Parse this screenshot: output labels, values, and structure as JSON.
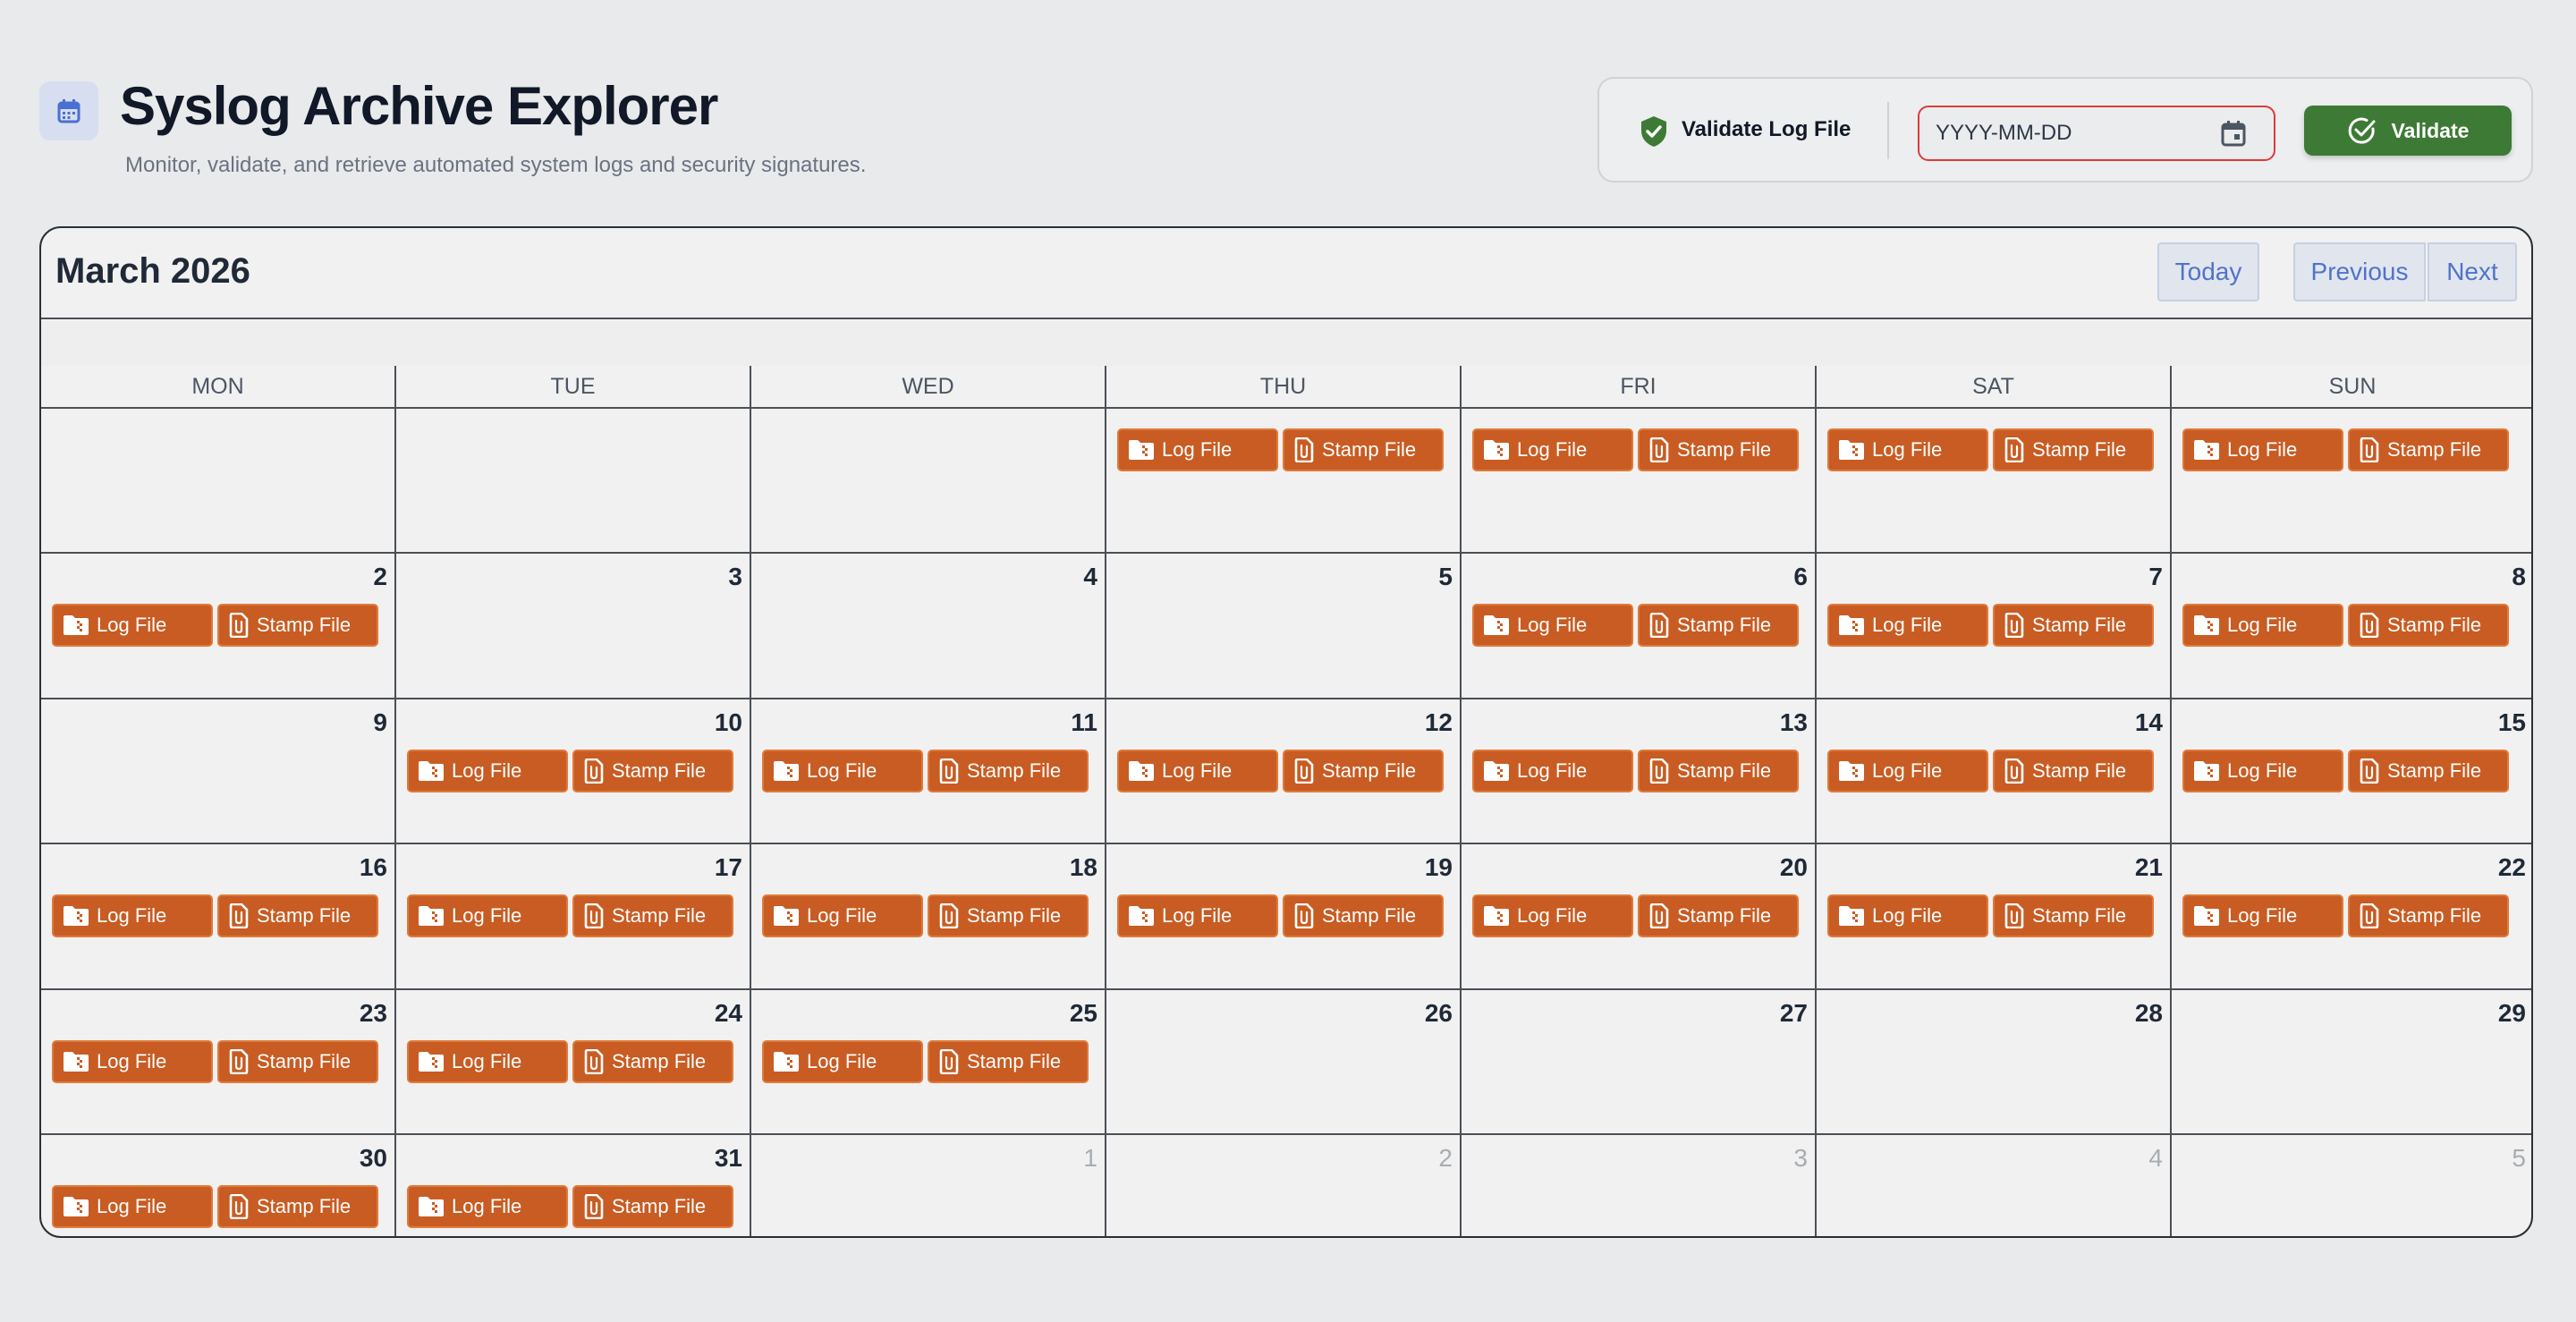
{
  "header": {
    "title": "Syslog Archive Explorer",
    "subtitle": "Monitor, validate, and retrieve automated system logs and security signatures.",
    "icon": "calendar-icon"
  },
  "validate": {
    "label": "Validate Log File",
    "placeholder": "YYYY-MM-DD",
    "value": "",
    "button_label": "Validate",
    "icons": [
      "shield-check-icon",
      "calendar-icon",
      "check-circle-icon"
    ],
    "colors": {
      "button": "#3d7a35",
      "input_border": "#dc3b3b",
      "shield": "#3d7a35"
    }
  },
  "calendar": {
    "title": "March 2026",
    "today_label": "Today",
    "previous_label": "Previous",
    "next_label": "Next",
    "day_headers": [
      "MON",
      "TUE",
      "WED",
      "THU",
      "FRI",
      "SAT",
      "SUN"
    ],
    "event_labels": {
      "log": "Log File",
      "stamp": "Stamp File"
    },
    "event_icons": {
      "log": "folder-zip-icon",
      "stamp": "file-attachment-icon"
    },
    "event_color": "#c85c23",
    "weeks": [
      [
        {
          "day": "",
          "other": false,
          "events": false
        },
        {
          "day": "",
          "other": false,
          "events": false
        },
        {
          "day": "",
          "other": false,
          "events": false
        },
        {
          "day": "",
          "other": false,
          "events": true
        },
        {
          "day": "",
          "other": false,
          "events": true
        },
        {
          "day": "",
          "other": false,
          "events": true
        },
        {
          "day": "",
          "other": false,
          "events": true
        }
      ],
      [
        {
          "day": "2",
          "other": false,
          "events": true
        },
        {
          "day": "3",
          "other": false,
          "events": false
        },
        {
          "day": "4",
          "other": false,
          "events": false
        },
        {
          "day": "5",
          "other": false,
          "events": false
        },
        {
          "day": "6",
          "other": false,
          "events": true
        },
        {
          "day": "7",
          "other": false,
          "events": true
        },
        {
          "day": "8",
          "other": false,
          "events": true
        }
      ],
      [
        {
          "day": "9",
          "other": false,
          "events": false
        },
        {
          "day": "10",
          "other": false,
          "events": true
        },
        {
          "day": "11",
          "other": false,
          "events": true
        },
        {
          "day": "12",
          "other": false,
          "events": true
        },
        {
          "day": "13",
          "other": false,
          "events": true
        },
        {
          "day": "14",
          "other": false,
          "events": true
        },
        {
          "day": "15",
          "other": false,
          "events": true
        }
      ],
      [
        {
          "day": "16",
          "other": false,
          "events": true
        },
        {
          "day": "17",
          "other": false,
          "events": true
        },
        {
          "day": "18",
          "other": false,
          "events": true
        },
        {
          "day": "19",
          "other": false,
          "events": true
        },
        {
          "day": "20",
          "other": false,
          "events": true
        },
        {
          "day": "21",
          "other": false,
          "events": true
        },
        {
          "day": "22",
          "other": false,
          "events": true
        }
      ],
      [
        {
          "day": "23",
          "other": false,
          "events": true
        },
        {
          "day": "24",
          "other": false,
          "events": true
        },
        {
          "day": "25",
          "other": false,
          "events": true
        },
        {
          "day": "26",
          "other": false,
          "events": false
        },
        {
          "day": "27",
          "other": false,
          "events": false
        },
        {
          "day": "28",
          "other": false,
          "events": false
        },
        {
          "day": "29",
          "other": false,
          "events": false
        }
      ],
      [
        {
          "day": "30",
          "other": false,
          "events": true
        },
        {
          "day": "31",
          "other": false,
          "events": true
        },
        {
          "day": "1",
          "other": true,
          "events": false
        },
        {
          "day": "2",
          "other": true,
          "events": false
        },
        {
          "day": "3",
          "other": true,
          "events": false
        },
        {
          "day": "4",
          "other": true,
          "events": false
        },
        {
          "day": "5",
          "other": true,
          "events": false
        }
      ]
    ]
  }
}
